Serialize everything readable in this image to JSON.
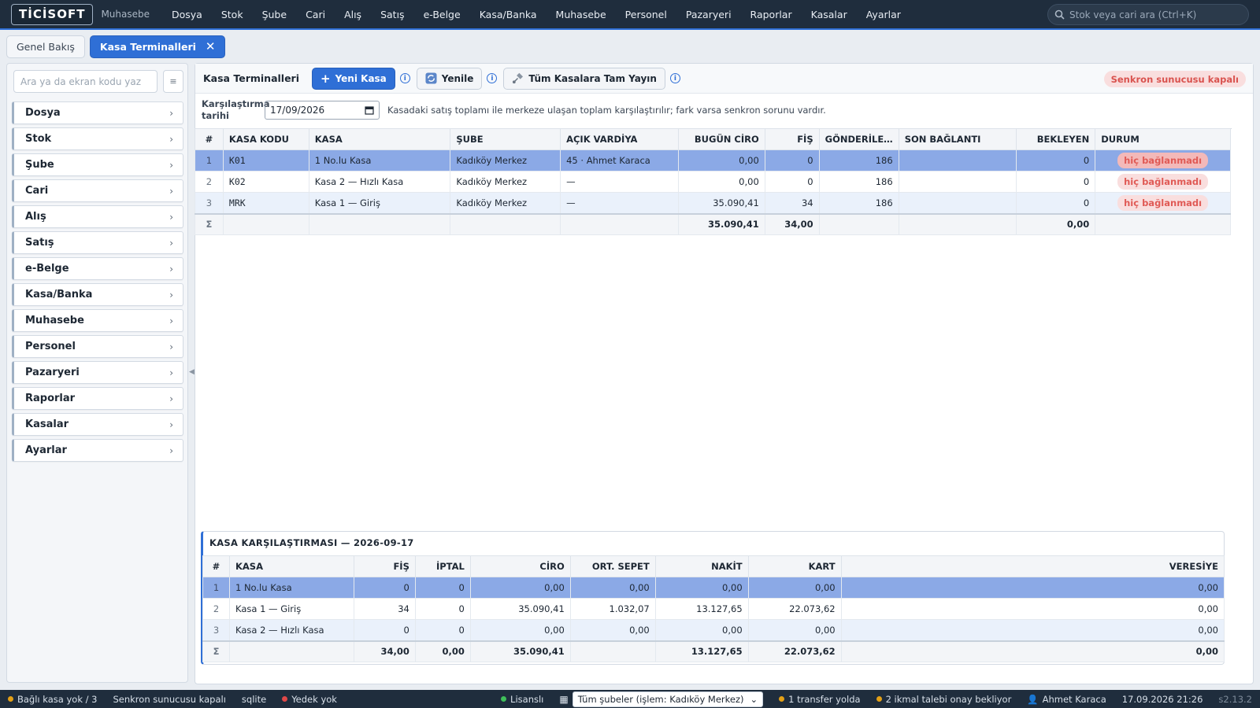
{
  "app": {
    "logo": "TİCİSOFT",
    "module": "Muhasebe"
  },
  "menu": [
    "Dosya",
    "Stok",
    "Şube",
    "Cari",
    "Alış",
    "Satış",
    "e-Belge",
    "Kasa/Banka",
    "Muhasebe",
    "Personel",
    "Pazaryeri",
    "Raporlar",
    "Kasalar",
    "Ayarlar"
  ],
  "search": {
    "placeholder": "Stok veya cari ara (Ctrl+K)"
  },
  "tabs": {
    "overview": "Genel Bakış",
    "active": "Kasa Terminalleri",
    "close": "✕"
  },
  "sidebar": {
    "search_placeholder": "Ara ya da ekran kodu yaz",
    "items": [
      "Dosya",
      "Stok",
      "Şube",
      "Cari",
      "Alış",
      "Satış",
      "e-Belge",
      "Kasa/Banka",
      "Muhasebe",
      "Personel",
      "Pazaryeri",
      "Raporlar",
      "Kasalar",
      "Ayarlar"
    ]
  },
  "toolbar": {
    "title": "Kasa Terminalleri",
    "new_label": "Yeni Kasa",
    "refresh_label": "Yenile",
    "broadcast_label": "Tüm Kasalara Tam Yayın",
    "sync_status": "Senkron sunucusu kapalı"
  },
  "datebar": {
    "label_line1": "Karşılaştırma",
    "label_line2": "tarihi",
    "value": "17/09/2026",
    "hint": "Kasadaki satış toplamı ile merkeze ulaşan toplam karşılaştırılır; fark varsa senkron sorunu vardır."
  },
  "terminals": {
    "headers": [
      "#",
      "KASA KODU",
      "KASA",
      "ŞUBE",
      "AÇIK VARDİYA",
      "BUGÜN CİRO",
      "FİŞ",
      "GÖNDERİLE…",
      "SON BAĞLANTI",
      "BEKLEYEN",
      "DURUM"
    ],
    "rows": [
      [
        "1",
        "K01",
        "1 No.lu Kasa",
        "Kadıköy Merkez",
        "45 · Ahmet Karaca",
        "0,00",
        "0",
        "186",
        "",
        "0",
        "hiç bağlanmadı"
      ],
      [
        "2",
        "K02",
        "Kasa 2 — Hızlı Kasa",
        "Kadıköy Merkez",
        "—",
        "0,00",
        "0",
        "186",
        "",
        "0",
        "hiç bağlanmadı"
      ],
      [
        "3",
        "MRK",
        "Kasa 1 — Giriş",
        "Kadıköy Merkez",
        "—",
        "35.090,41",
        "34",
        "186",
        "",
        "0",
        "hiç bağlanmadı"
      ]
    ],
    "sum": {
      "label": "Σ",
      "ciro": "35.090,41",
      "fis": "34,00",
      "bekleyen": "0,00"
    }
  },
  "comparison": {
    "title": "KASA KARŞILAŞTIRMASI — 2026-09-17",
    "headers": [
      "#",
      "KASA",
      "FİŞ",
      "İPTAL",
      "CİRO",
      "ORT. SEPET",
      "NAKİT",
      "KART",
      "VERESİYE"
    ],
    "rows": [
      [
        "1",
        "1 No.lu Kasa",
        "0",
        "0",
        "0,00",
        "0,00",
        "0,00",
        "0,00",
        "0,00"
      ],
      [
        "2",
        "Kasa 1 — Giriş",
        "34",
        "0",
        "35.090,41",
        "1.032,07",
        "13.127,65",
        "22.073,62",
        "0,00"
      ],
      [
        "3",
        "Kasa 2 — Hızlı Kasa",
        "0",
        "0",
        "0,00",
        "0,00",
        "0,00",
        "0,00",
        "0,00"
      ]
    ],
    "sum": {
      "label": "Σ",
      "fis": "34,00",
      "iptal": "0,00",
      "ciro": "35.090,41",
      "nakit": "13.127,65",
      "kart": "22.073,62",
      "veresiye": "0,00"
    }
  },
  "statusbar": {
    "kasa": "Bağlı kasa yok / 3",
    "sync": "Senkron sunucusu kapalı",
    "db": "sqlite",
    "backup": "Yedek yok",
    "license": "Lisanslı",
    "branch_select": "Tüm şubeler (işlem: Kadıköy Merkez)",
    "transfer": "1 transfer yolda",
    "ikmal": "2 ikmal talebi onay bekliyor",
    "user": "Ahmet Karaca",
    "datetime": "17.09.2026 21:26",
    "version": "s2.13.2"
  },
  "colors": {
    "accent": "#2f6fd6",
    "topbar": "#1f2d3d",
    "danger": "#e05a55",
    "selected_row": "#8ba9e6"
  }
}
